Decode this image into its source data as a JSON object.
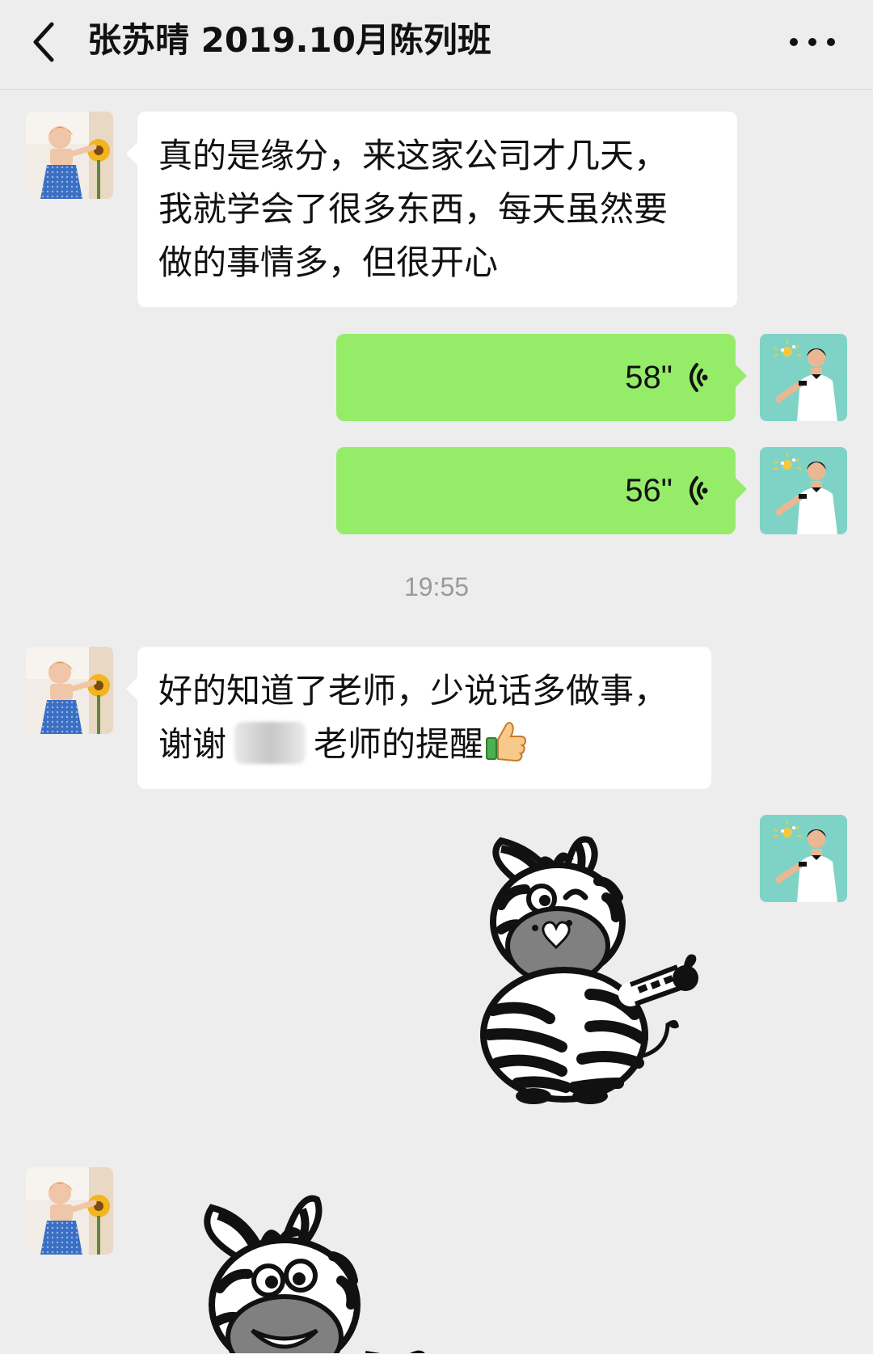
{
  "header": {
    "title": "张苏晴 2019.10月陈列班",
    "back_icon": "chevron-left-icon",
    "more_icon": "more-dots-icon"
  },
  "messages": [
    {
      "side": "left",
      "type": "text",
      "lines": [
        "真的是缘分，来这家公司才几天，",
        "我就学会了很多东西，每天虽然要",
        "做的事情多，但很开心"
      ]
    },
    {
      "side": "right",
      "type": "voice",
      "duration": "58\"",
      "icon": "voice-wave-icon"
    },
    {
      "side": "right",
      "type": "voice",
      "duration": "56\"",
      "icon": "voice-wave-icon"
    },
    {
      "type": "timestamp",
      "text": "19:55"
    },
    {
      "side": "left",
      "type": "text",
      "lines": [
        "好的知道了老师，少说话多做事，",
        "谢谢",
        "老师的提醒"
      ],
      "emoji": "thumbs-up-icon"
    },
    {
      "side": "right",
      "type": "sticker",
      "sticker": "zebra-thumbs-up-sticker"
    },
    {
      "side": "left",
      "type": "sticker",
      "sticker": "zebra-laughing-sticker"
    }
  ],
  "colors": {
    "background": "#ededed",
    "bubble_in": "#ffffff",
    "bubble_out": "#95ec69",
    "timestamp": "#9a9a9a"
  }
}
